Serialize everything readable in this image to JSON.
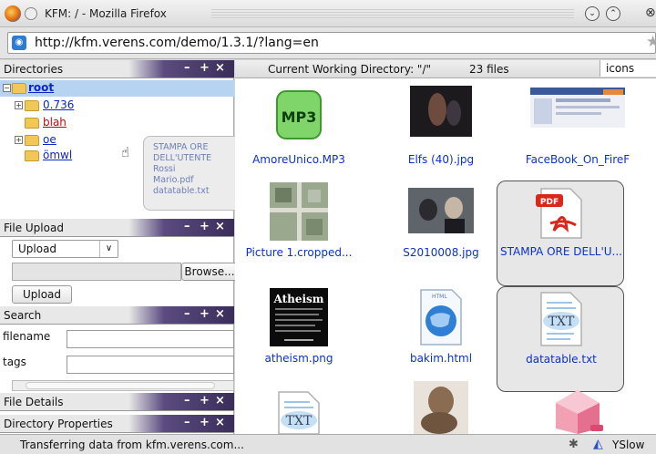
{
  "window": {
    "title": "KFM: / - Mozilla Firefox"
  },
  "urlbar": {
    "url": "http://kfm.verens.com/demo/1.3.1/?lang=en"
  },
  "directories": {
    "title": "Directories",
    "root": "root",
    "items": [
      "0.736",
      "blah",
      "oe",
      "ömwl"
    ]
  },
  "tooltip": {
    "lines": [
      "STAMPA ORE",
      "DELL'UTENTE Rossi",
      "Mario.pdf",
      "datatable.txt"
    ]
  },
  "upload": {
    "title": "File Upload",
    "select_value": "Upload",
    "browse_label": "Browse...",
    "upload_label": "Upload"
  },
  "search": {
    "title": "Search",
    "filename_label": "filename",
    "tags_label": "tags"
  },
  "file_details": {
    "title": "File Details"
  },
  "directory_properties": {
    "title": "Directory Properties"
  },
  "header": {
    "cwd_label": "Current Working Directory: \"/\"",
    "count": "23 files",
    "view_mode": "icons"
  },
  "files": [
    {
      "name": "AmoreUnico.MP3"
    },
    {
      "name": "Elfs (40).jpg"
    },
    {
      "name": "FaceBook_On_FireF"
    },
    {
      "name": "Picture 1.cropped..."
    },
    {
      "name": "S2010008.jpg"
    },
    {
      "name": "STAMPA ORE DELL'U..."
    },
    {
      "name": "atheism.png"
    },
    {
      "name": "bakim.html"
    },
    {
      "name": "datatable.txt"
    }
  ],
  "thumb_text": {
    "mp3": "MP3",
    "pdf": "PDF",
    "txt": "TXT",
    "atheism": "Atheism",
    "html": "HTML"
  },
  "status": {
    "text": "Transferring data from kfm.verens.com...",
    "yslow": "YSlow"
  },
  "panel_buttons": {
    "minimize": "–",
    "maximize": "+",
    "close": "×"
  }
}
